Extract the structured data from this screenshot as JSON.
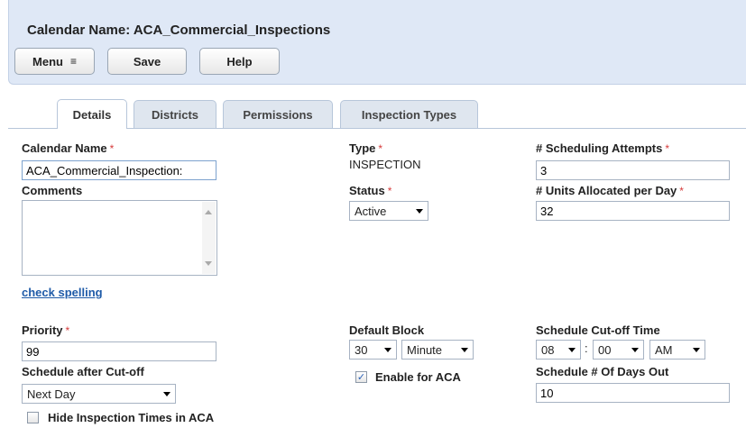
{
  "header": {
    "title": "Calendar Name: ACA_Commercial_Inspections",
    "menu_label": "Menu",
    "menu_icon": "≡",
    "save_label": "Save",
    "help_label": "Help"
  },
  "tabs": [
    {
      "label": "Details",
      "active": true
    },
    {
      "label": "Districts",
      "active": false
    },
    {
      "label": "Permissions",
      "active": false
    },
    {
      "label": "Inspection Types",
      "active": false
    }
  ],
  "required_mark": "*",
  "form": {
    "calendar_name": {
      "label": "Calendar Name",
      "value": "ACA_Commercial_Inspection:"
    },
    "comments": {
      "label": "Comments",
      "value": ""
    },
    "check_spelling": "check spelling",
    "type": {
      "label": "Type",
      "value": "INSPECTION"
    },
    "status": {
      "label": "Status",
      "value": "Active"
    },
    "scheduling_attempts": {
      "label": "# Scheduling Attempts",
      "value": "3"
    },
    "units_per_day": {
      "label": "# Units Allocated per Day",
      "value": "32"
    },
    "priority": {
      "label": "Priority",
      "value": "99"
    },
    "default_block": {
      "label": "Default Block",
      "amount": "30",
      "unit": "Minute"
    },
    "cutoff_time": {
      "label": "Schedule Cut-off Time",
      "hour": "08",
      "separator": ":",
      "minute": "00",
      "ampm": "AM"
    },
    "after_cutoff": {
      "label": "Schedule after Cut-off",
      "value": "Next Day"
    },
    "enable_aca": {
      "label": "Enable for ACA",
      "checked": true,
      "mark": "✓"
    },
    "days_out": {
      "label": "Schedule # Of Days Out",
      "value": "10"
    },
    "hide_times": {
      "label": "Hide Inspection Times in ACA",
      "checked": false
    }
  }
}
